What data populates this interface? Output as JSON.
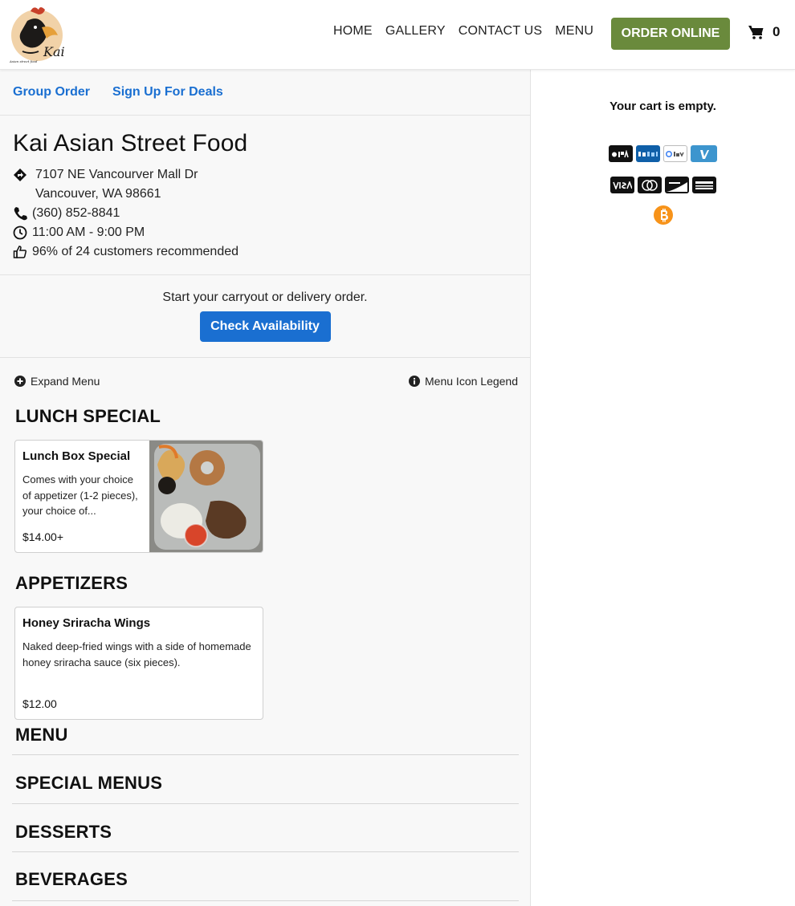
{
  "nav": {
    "links": [
      "HOME",
      "GALLERY",
      "CONTACT US",
      "MENU"
    ],
    "order_online": "ORDER ONLINE",
    "cart_count": "0"
  },
  "colors": {
    "order_green": "#6a8a3c",
    "link_blue": "#1a6fd1",
    "bitcoin": "#f7931a"
  },
  "top_links": {
    "group_order": "Group Order",
    "deals": "Sign Up For Deals"
  },
  "restaurant": {
    "name": "Kai Asian Street Food",
    "address_line1": "7107 NE Vancourver Mall Dr",
    "address_line2": "Vancouver, WA 98661",
    "phone": "(360) 852-8841",
    "hours": "11:00 AM - 9:00 PM",
    "recommend": "96% of 24 customers recommended"
  },
  "availability": {
    "prompt": "Start your carryout or delivery order.",
    "button": "Check Availability"
  },
  "menu_tools": {
    "expand": "Expand Menu",
    "legend": "Menu Icon Legend"
  },
  "sections": [
    {
      "title": "LUNCH SPECIAL",
      "items": [
        {
          "name": "Lunch Box Special",
          "desc": "Comes with your choice of appetizer (1-2 pieces), your choice of...",
          "price": "$14.00+"
        }
      ]
    },
    {
      "title": "APPETIZERS",
      "items": [
        {
          "name": "Honey Sriracha Wings",
          "desc": "Naked deep-fried wings with a side of homemade honey sriracha sauce (six pieces).",
          "price": "$12.00"
        }
      ]
    }
  ],
  "categories": [
    "MENU",
    "SPECIAL MENUS",
    "DESSERTS",
    "BEVERAGES"
  ],
  "cart": {
    "empty": "Your cart is empty.",
    "pay_row1": [
      "apple-pay",
      "paypal",
      "google-pay",
      "venmo"
    ],
    "pay_row2": [
      "visa",
      "mastercard",
      "discover",
      "amex"
    ],
    "pay_row3": [
      "bitcoin"
    ]
  }
}
